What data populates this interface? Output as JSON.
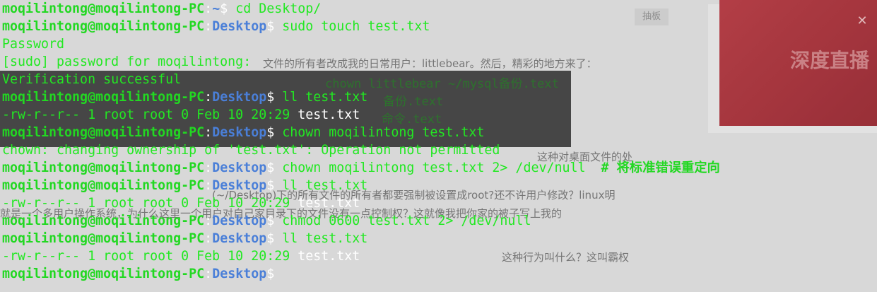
{
  "background_page": {
    "tag_label": "抽板",
    "banner_text": "深度直播",
    "lines": [
      "文件的所有者改成我的日常用户：littlebear。然后，精彩的地方来了：",
      "这种对桌面文件的处",
      "(~/Desktop)下的所有文件的所有者都要强制被设置成root?还不许用户修改？linux明",
      "就是一个多用户操作系统，为什么这里一个用户对自己家目录下的文件没有一点控制权？这就像我把你家的被子写上我的",
      "这种行为叫什么？这叫霸权"
    ],
    "code_lines": [
      "chown littlebear ~/mysql备份.text",
      "备份.text",
      "命令.text"
    ]
  },
  "terminal": {
    "lines": [
      {
        "type": "prompt",
        "user": "moqilintong@moqilintong-PC",
        "sep": ":",
        "cwd": "~",
        "end": "$ ",
        "cmd": "cd Desktop/"
      },
      {
        "type": "prompt",
        "user": "moqilintong@moqilintong-PC",
        "sep": ":",
        "cwd": "Desktop",
        "end": "$ ",
        "cmd": "sudo touch test.txt"
      },
      {
        "type": "output",
        "text": "Password"
      },
      {
        "type": "output",
        "text": "[sudo] password for moqilintong:"
      },
      {
        "type": "output",
        "text": "Verification successful"
      },
      {
        "type": "prompt",
        "user": "moqilintong@moqilintong-PC",
        "sep": ":",
        "cwd": "Desktop",
        "end": "$ ",
        "cmd": "ll test.txt"
      },
      {
        "type": "listing",
        "text": "-rw-r--r-- 1 root root 0 Feb 10 20:29 ",
        "file": "test.txt"
      },
      {
        "type": "prompt",
        "user": "moqilintong@moqilintong-PC",
        "sep": ":",
        "cwd": "Desktop",
        "end": "$ ",
        "cmd": "chown moqilintong test.txt"
      },
      {
        "type": "output",
        "text": "chown: changing ownership of 'test.txt': Operation not permitted"
      },
      {
        "type": "prompt",
        "user": "moqilintong@moqilintong-PC",
        "sep": ":",
        "cwd": "Desktop",
        "end": "$ ",
        "cmd": "chown moqilintong test.txt 2> /dev/null  ",
        "comment": "# 将标准错误重定向"
      },
      {
        "type": "prompt",
        "user": "moqilintong@moqilintong-PC",
        "sep": ":",
        "cwd": "Desktop",
        "end": "$ ",
        "cmd": "ll test.txt"
      },
      {
        "type": "listing",
        "text": "-rw-r--r-- 1 root root 0 Feb 10 20:29 ",
        "file": "test.txt"
      },
      {
        "type": "prompt",
        "user": "moqilintong@moqilintong-PC",
        "sep": ":",
        "cwd": "Desktop",
        "end": "$ ",
        "cmd": "chmod 0600 test.txt 2> /dev/null"
      },
      {
        "type": "prompt",
        "user": "moqilintong@moqilintong-PC",
        "sep": ":",
        "cwd": "Desktop",
        "end": "$ ",
        "cmd": "ll test.txt"
      },
      {
        "type": "listing",
        "text": "-rw-r--r-- 1 root root 0 Feb 10 20:29 ",
        "file": "test.txt"
      },
      {
        "type": "prompt",
        "user": "moqilintong@moqilintong-PC",
        "sep": ":",
        "cwd": "Desktop",
        "end": "$",
        "cmd": ""
      }
    ]
  }
}
